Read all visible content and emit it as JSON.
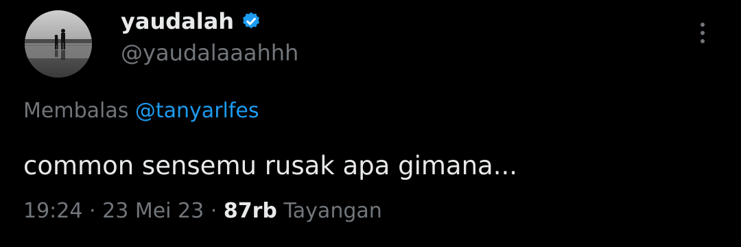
{
  "author": {
    "display_name": "yaudalah",
    "handle": "@yaudalaaahhh",
    "verified": true,
    "verified_color": "#1d9bf0"
  },
  "reply": {
    "prefix": "Membalas",
    "mention": "@tanyarlfes"
  },
  "tweet": {
    "text": "common sensemu rusak apa gimana..."
  },
  "meta": {
    "time": "19:24",
    "separator": "·",
    "date": "23 Mei 23",
    "views_count": "87rb",
    "views_label": "Tayangan"
  },
  "icons": {
    "more": "more-vertical-icon",
    "verified": "verified-badge-icon"
  }
}
